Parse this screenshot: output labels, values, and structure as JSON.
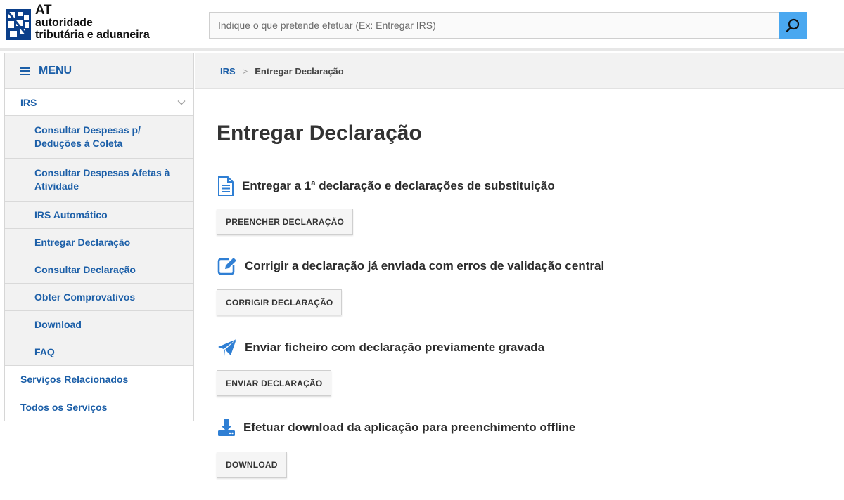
{
  "brand": {
    "short": "AT",
    "line2": "autoridade",
    "line3": "tributária e aduaneira"
  },
  "search": {
    "placeholder": "Indique o que pretende efetuar (Ex: Entregar IRS)",
    "value": ""
  },
  "menu": {
    "label": "MENU"
  },
  "sidebar": {
    "top": "IRS",
    "items": [
      "Consultar Despesas p/ Deduções à Coleta",
      "Consultar Despesas Afetas à Atividade",
      "IRS Automático",
      "Entregar Declaração",
      "Consultar Declaração",
      "Obter Comprovativos",
      "Download",
      "FAQ"
    ],
    "bottom": [
      "Serviços Relacionados",
      "Todos os Serviços"
    ]
  },
  "breadcrumb": {
    "root": "IRS",
    "separator": ">",
    "current": "Entregar Declaração"
  },
  "page": {
    "title": "Entregar Declaração"
  },
  "sections": [
    {
      "icon": "document-icon",
      "heading": "Entregar a 1ª declaração e declarações de substituição",
      "button": "PREENCHER DECLARAÇÃO"
    },
    {
      "icon": "edit-icon",
      "heading": "Corrigir a declaração já enviada com erros de validação central",
      "button": "CORRIGIR DECLARAÇÃO"
    },
    {
      "icon": "paper-plane-icon",
      "heading": "Enviar ficheiro com declaração previamente gravada",
      "button": "ENVIAR DECLARAÇÃO"
    },
    {
      "icon": "download-icon",
      "heading": "Efetuar download da aplicação para preenchimento offline",
      "button": "DOWNLOAD"
    }
  ],
  "colors": {
    "link": "#1c5fa8",
    "icon": "#2f7fd4",
    "search_button": "#4aa8f0",
    "panel": "#f2f2f2"
  }
}
